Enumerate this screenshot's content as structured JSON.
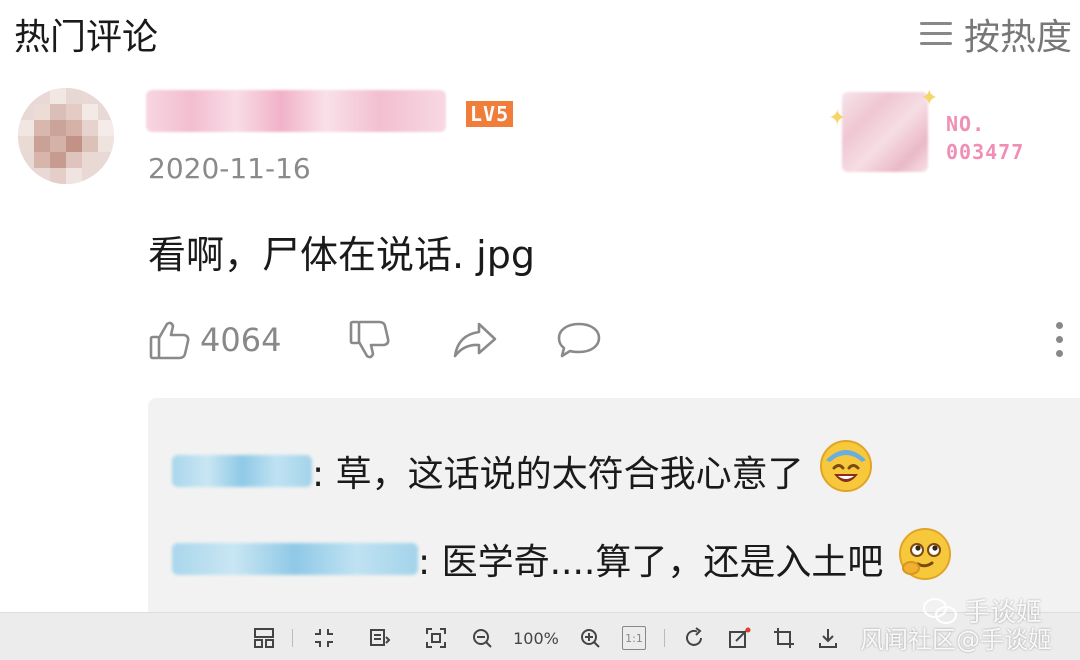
{
  "header": {
    "title": "热门评论",
    "sort_label": "按热度",
    "menu_icon": "hamburger-icon"
  },
  "comment": {
    "level_badge": "LV5",
    "fan_no_label": "NO.",
    "fan_no_value": "003477",
    "date": "2020-11-16",
    "text": "看啊，尸体在说话. jpg",
    "like_count": "4064"
  },
  "replies": [
    {
      "text": ": 草，这话说的太符合我心意了",
      "emoji": "laughing-emoji"
    },
    {
      "text": ": 医学奇....算了，还是入土吧",
      "emoji": "smirk-emoji"
    }
  ],
  "toolbar": {
    "zoom": "100%",
    "actual_size": "1:1"
  },
  "watermark": {
    "account": "手谈姬",
    "community": "风闻社区@手谈姬"
  },
  "colors": {
    "level_badge": "#f07e3a",
    "fan_number": "#f08fb6",
    "reply_background": "#f2f2f2",
    "secondary_text": "#8a8a8a"
  }
}
